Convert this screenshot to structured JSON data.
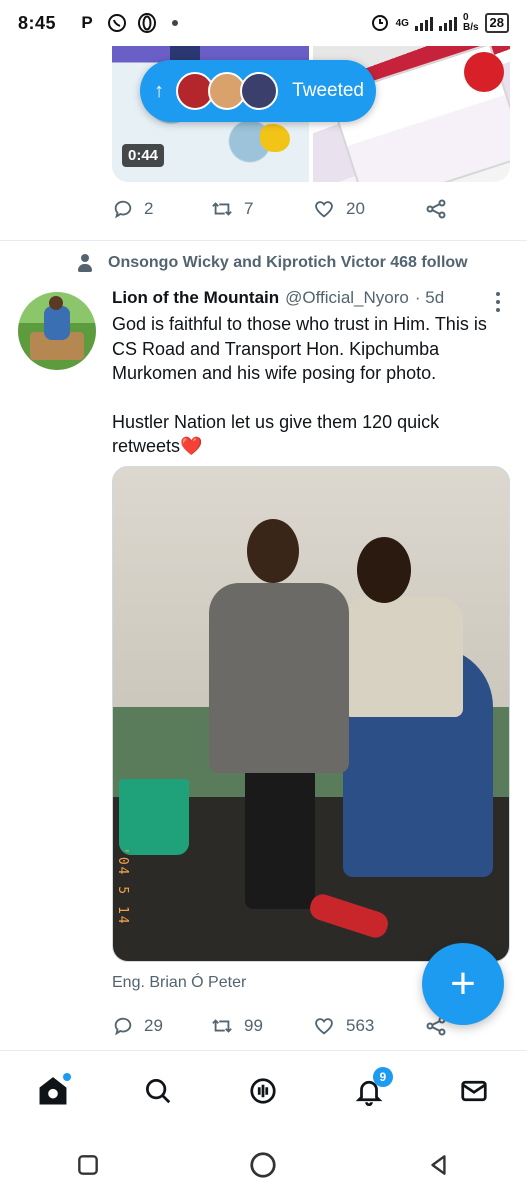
{
  "status_bar": {
    "time": "8:45",
    "app_icons": [
      "p-icon",
      "whatsapp-icon",
      "opera-icon"
    ],
    "network": "4G",
    "data_rate_value": "0",
    "data_rate_unit": "B/s",
    "battery": "28"
  },
  "top_tweet": {
    "video_duration": "0:44",
    "tweeted_pill_label": "Tweeted",
    "actions": {
      "replies": "2",
      "retweets": "7",
      "likes": "20"
    }
  },
  "tweet": {
    "social_context": "Onsongo Wicky and Kiprotich Victor 468 follow",
    "author_name": "Lion of the Mountain",
    "author_handle": "@Official_Nyoro",
    "time_ago": "· 5d",
    "text_p1": "God is faithful to those who trust in Him. This is CS Road and Transport Hon. Kipchumba Murkomen and his wife posing for photo.",
    "text_p2": "Hustler Nation let us give them 120 quick retweets",
    "text_p2_emoji": "❤️",
    "photo_stamp": "'04 5 14",
    "photo_credit": "Eng. Brian Ó Peter",
    "actions": {
      "replies": "29",
      "retweets": "99",
      "likes": "563"
    }
  },
  "fab": {
    "label": "+"
  },
  "bottom_nav": {
    "items": [
      "home",
      "search",
      "spaces",
      "notifications",
      "messages"
    ],
    "notification_count": "9"
  },
  "colors": {
    "accent": "#1d9bf0",
    "secondary_text": "#536471",
    "heart": "#e0245e"
  }
}
